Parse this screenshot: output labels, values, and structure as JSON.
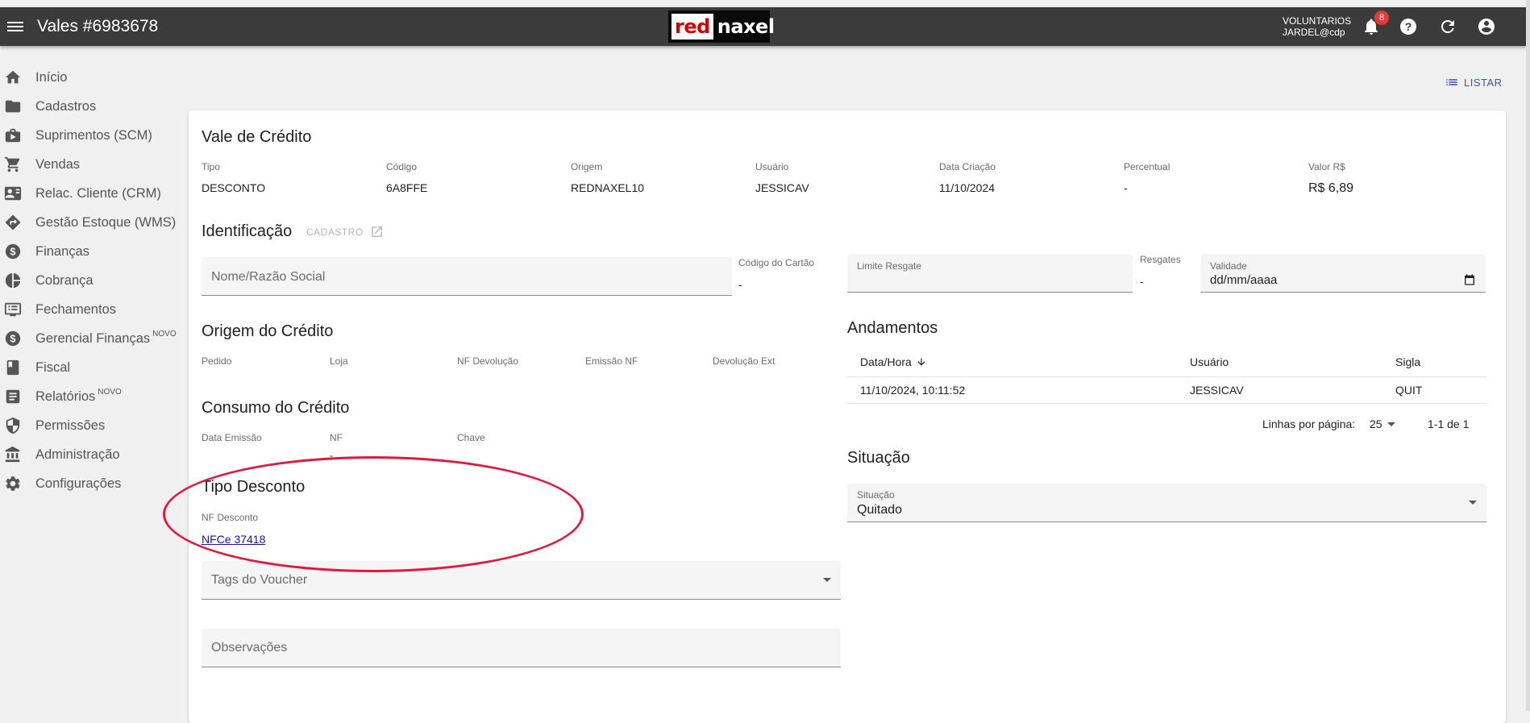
{
  "topbar": {
    "title": "Vales #6983678",
    "logo_red": "red",
    "logo_white": "naxel",
    "user_line1": "VOLUNTARIOS",
    "user_line2": "JARDEL@cdp",
    "notification_count": "8"
  },
  "sidebar": {
    "items": [
      {
        "label": "Início",
        "icon": "home-icon"
      },
      {
        "label": "Cadastros",
        "icon": "folder-icon"
      },
      {
        "label": "Suprimentos (SCM)",
        "icon": "supply-box-icon"
      },
      {
        "label": "Vendas",
        "icon": "cart-icon"
      },
      {
        "label": "Relac. Cliente (CRM)",
        "icon": "contact-card-icon"
      },
      {
        "label": "Gestão Estoque (WMS)",
        "icon": "directions-icon"
      },
      {
        "label": "Finanças",
        "icon": "dollar-circle-icon"
      },
      {
        "label": "Cobrança",
        "icon": "pie-chart-icon"
      },
      {
        "label": "Fechamentos",
        "icon": "receipt-list-icon"
      },
      {
        "label": "Gerencial Finanças",
        "icon": "dollar-circle-icon",
        "badge": "NOVO"
      },
      {
        "label": "Fiscal",
        "icon": "book-icon"
      },
      {
        "label": "Relatórios",
        "icon": "report-icon",
        "badge": "NOVO"
      },
      {
        "label": "Permissões",
        "icon": "shield-icon"
      },
      {
        "label": "Administração",
        "icon": "bank-icon"
      },
      {
        "label": "Configurações",
        "icon": "gear-icon"
      }
    ]
  },
  "actions": {
    "listar": "LISTAR"
  },
  "vale": {
    "title": "Vale de Crédito",
    "fields": [
      {
        "label": "Tipo",
        "value": "DESCONTO"
      },
      {
        "label": "Código",
        "value": "6A8FFE"
      },
      {
        "label": "Origem",
        "value": "REDNAXEL10"
      },
      {
        "label": "Usuário",
        "value": "JESSICAV"
      },
      {
        "label": "Data Criação",
        "value": "11/10/2024"
      },
      {
        "label": "Percentual",
        "value": "-"
      },
      {
        "label": "Valor R$",
        "value": "R$ 6,89"
      }
    ]
  },
  "identificacao": {
    "title": "Identificação",
    "cadastro_link": "CADASTRO",
    "nome_placeholder": "Nome/Razão Social",
    "codigo_cartao_label": "Código do Cartão",
    "codigo_cartao_value": "-",
    "limite_resgate_label": "Limite Resgate",
    "resgates_label": "Resgates",
    "resgates_value": "-",
    "validade_label": "Validade",
    "validade_value": "dd/mm/aaaa"
  },
  "origem": {
    "title": "Origem do Crédito",
    "columns": [
      "Pedido",
      "Loja",
      "NF Devolução",
      "Emissão NF",
      "Devolução Ext"
    ]
  },
  "consumo": {
    "title": "Consumo do Crédito",
    "columns": [
      "Data Emissão",
      "NF",
      "Chave"
    ],
    "nf_value": "-"
  },
  "tipo_desconto": {
    "title": "Tipo Desconto",
    "nf_label": "NF Desconto",
    "nf_link": "NFCe 37418"
  },
  "tags": {
    "placeholder": "Tags do Voucher"
  },
  "observacoes": {
    "placeholder": "Observações"
  },
  "andamentos": {
    "title": "Andamentos",
    "headers": [
      "Data/Hora",
      "Usuário",
      "Sigla"
    ],
    "rows": [
      {
        "data": "11/10/2024, 10:11:52",
        "usuario": "JESSICAV",
        "sigla": "QUIT"
      }
    ],
    "rows_per_page_label": "Linhas por página:",
    "rows_per_page": "25",
    "range": "1-1 de 1"
  },
  "situacao": {
    "title": "Situação",
    "label": "Situação",
    "value": "Quitado"
  },
  "colors": {
    "topbar": "#3b3b3b",
    "accent": "#3f51b5",
    "highlight": "#e01a3e",
    "badge": "#e53935"
  }
}
